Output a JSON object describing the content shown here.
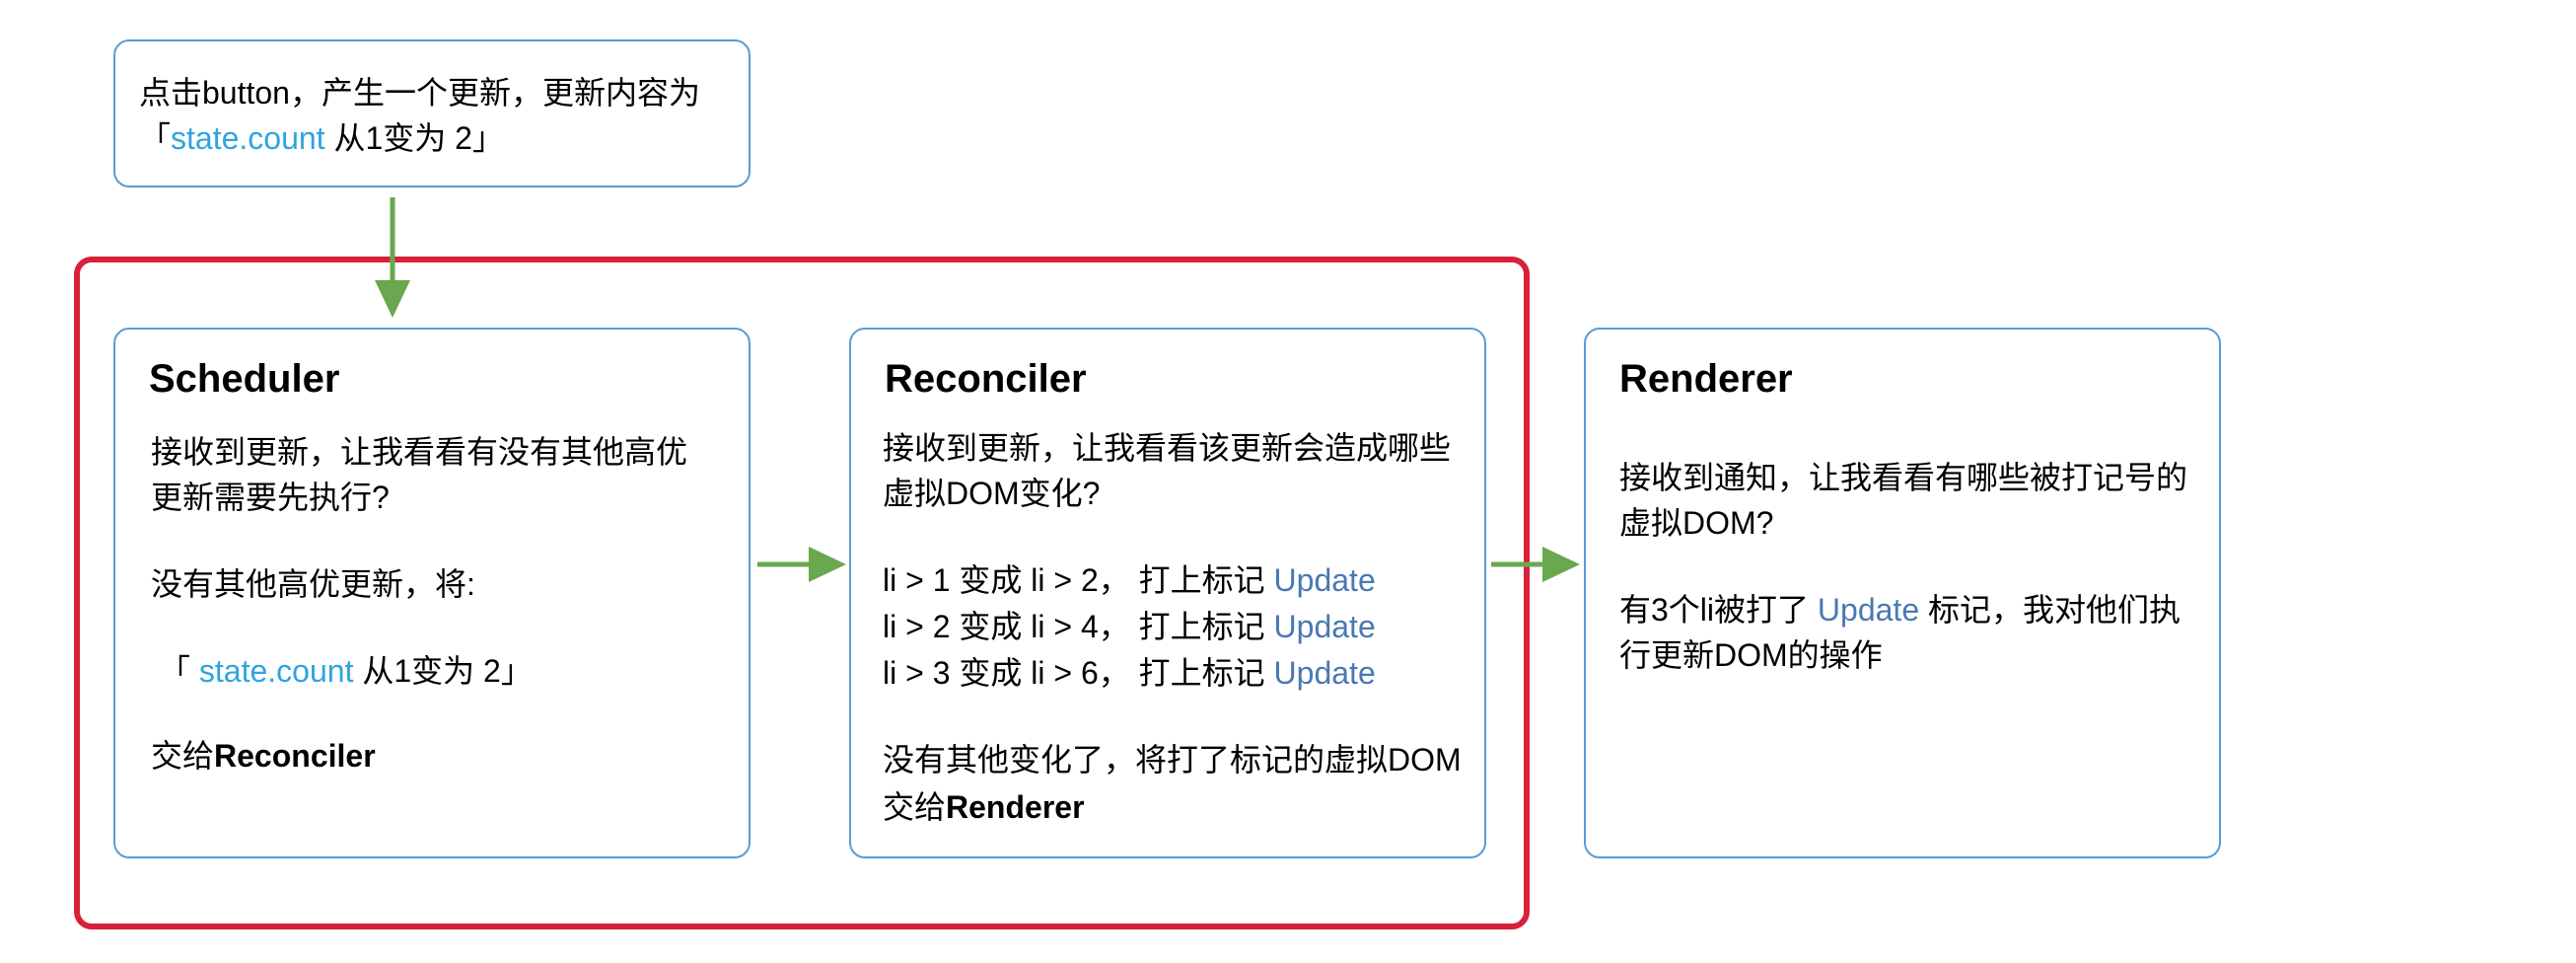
{
  "trigger": {
    "line1": "点击button，产生一个更新，更新内容为",
    "line2_open": "「",
    "line2_highlight": "state.count",
    "line2_rest": " 从1变为 2」"
  },
  "scheduler": {
    "title": "Scheduler",
    "line1": "接收到更新，让我看看有没有其他高优",
    "line2": "更新需要先执行?",
    "line3": "没有其他高优更新，将:",
    "line4_open": "「 ",
    "line4_highlight": "state.count",
    "line4_rest": " 从1变为 2」",
    "line5_prefix": "交给",
    "line5_bold": "Reconciler"
  },
  "reconciler": {
    "title": "Reconciler",
    "line1": "接收到更新，让我看看该更新会造成哪些",
    "line2": "虚拟DOM变化?",
    "changes": [
      {
        "text": "li > 1 变成 li > 2， 打上标记 ",
        "tag": "Update"
      },
      {
        "text": "li > 2 变成 li > 4， 打上标记 ",
        "tag": "Update"
      },
      {
        "text": "li > 3 变成 li > 6， 打上标记 ",
        "tag": "Update"
      }
    ],
    "line6": "没有其他变化了，将打了标记的虚拟DOM",
    "line7_prefix": "交给",
    "line7_bold": "Renderer"
  },
  "renderer": {
    "title": "Renderer",
    "line1": "接收到通知，让我看看有哪些被打记号的",
    "line2": "虚拟DOM?",
    "line3_prefix": "有3个li被打了 ",
    "line3_tag": "Update",
    "line3_rest": " 标记，我对他们执",
    "line4": "行更新DOM的操作"
  },
  "colors": {
    "box_border": "#5b9bd5",
    "group_border": "#d9203a",
    "arrow": "#6aa84f",
    "highlight": "#2fa4e0",
    "update_tag": "#4a78b4"
  }
}
